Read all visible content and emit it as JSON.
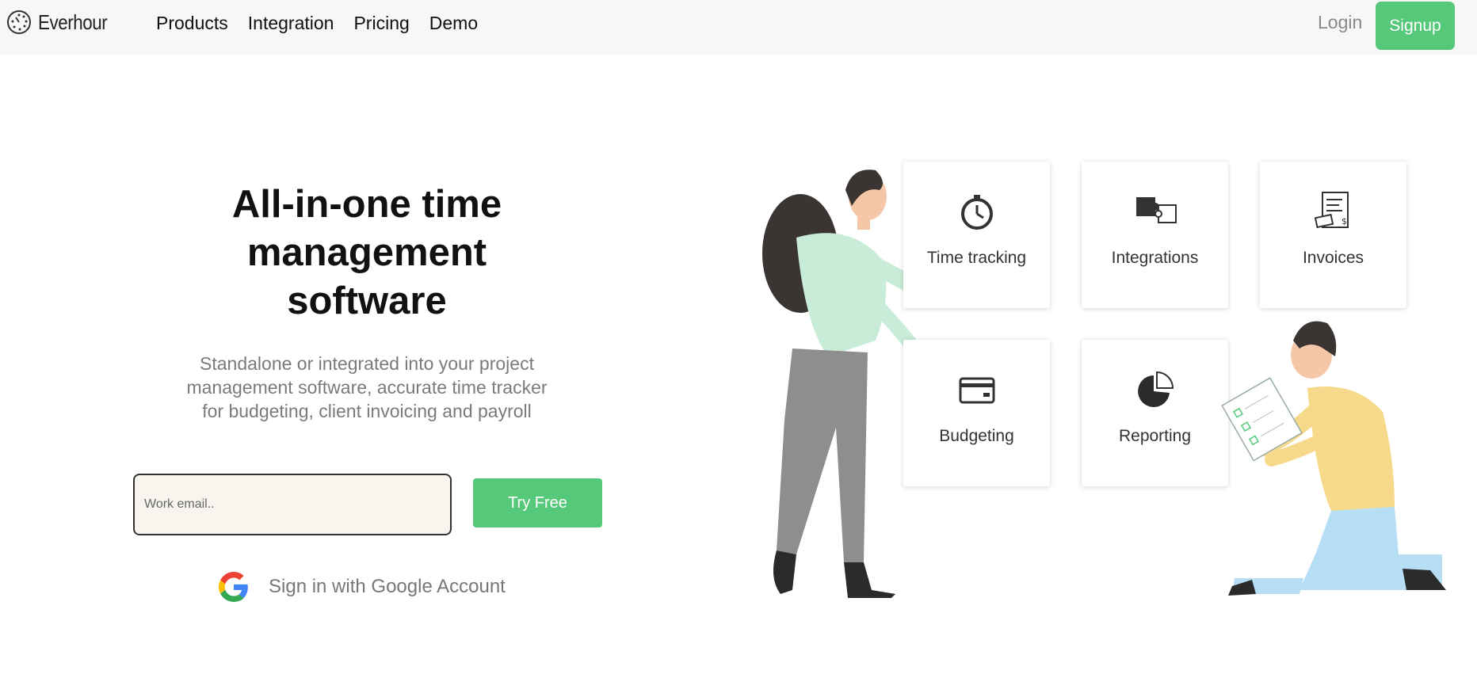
{
  "header": {
    "logo_text": "Everhour",
    "nav": [
      "Products",
      "Integration",
      "Pricing",
      "Demo"
    ],
    "login_label": "Login",
    "signup_label": "Signup"
  },
  "hero": {
    "title_lines": [
      "All-in-one time",
      "management",
      "software"
    ],
    "subtitle_lines": [
      "Standalone or integrated into your project",
      "management software, accurate time tracker",
      "for budgeting, client invoicing and payroll"
    ],
    "email_placeholder": "Work email..",
    "try_label": "Try Free",
    "google_label": "Sign in with Google Account"
  },
  "features": [
    {
      "label": "Time tracking",
      "icon": "stopwatch-icon"
    },
    {
      "label": "Integrations",
      "icon": "puzzle-icon"
    },
    {
      "label": "Invoices",
      "icon": "invoice-icon"
    },
    {
      "label": "Budgeting",
      "icon": "card-icon"
    },
    {
      "label": "Reporting",
      "icon": "pie-chart-icon"
    }
  ],
  "colors": {
    "accent": "#55c87a",
    "header_bg": "#f6f7f6",
    "input_bg": "#f8f5ee"
  }
}
